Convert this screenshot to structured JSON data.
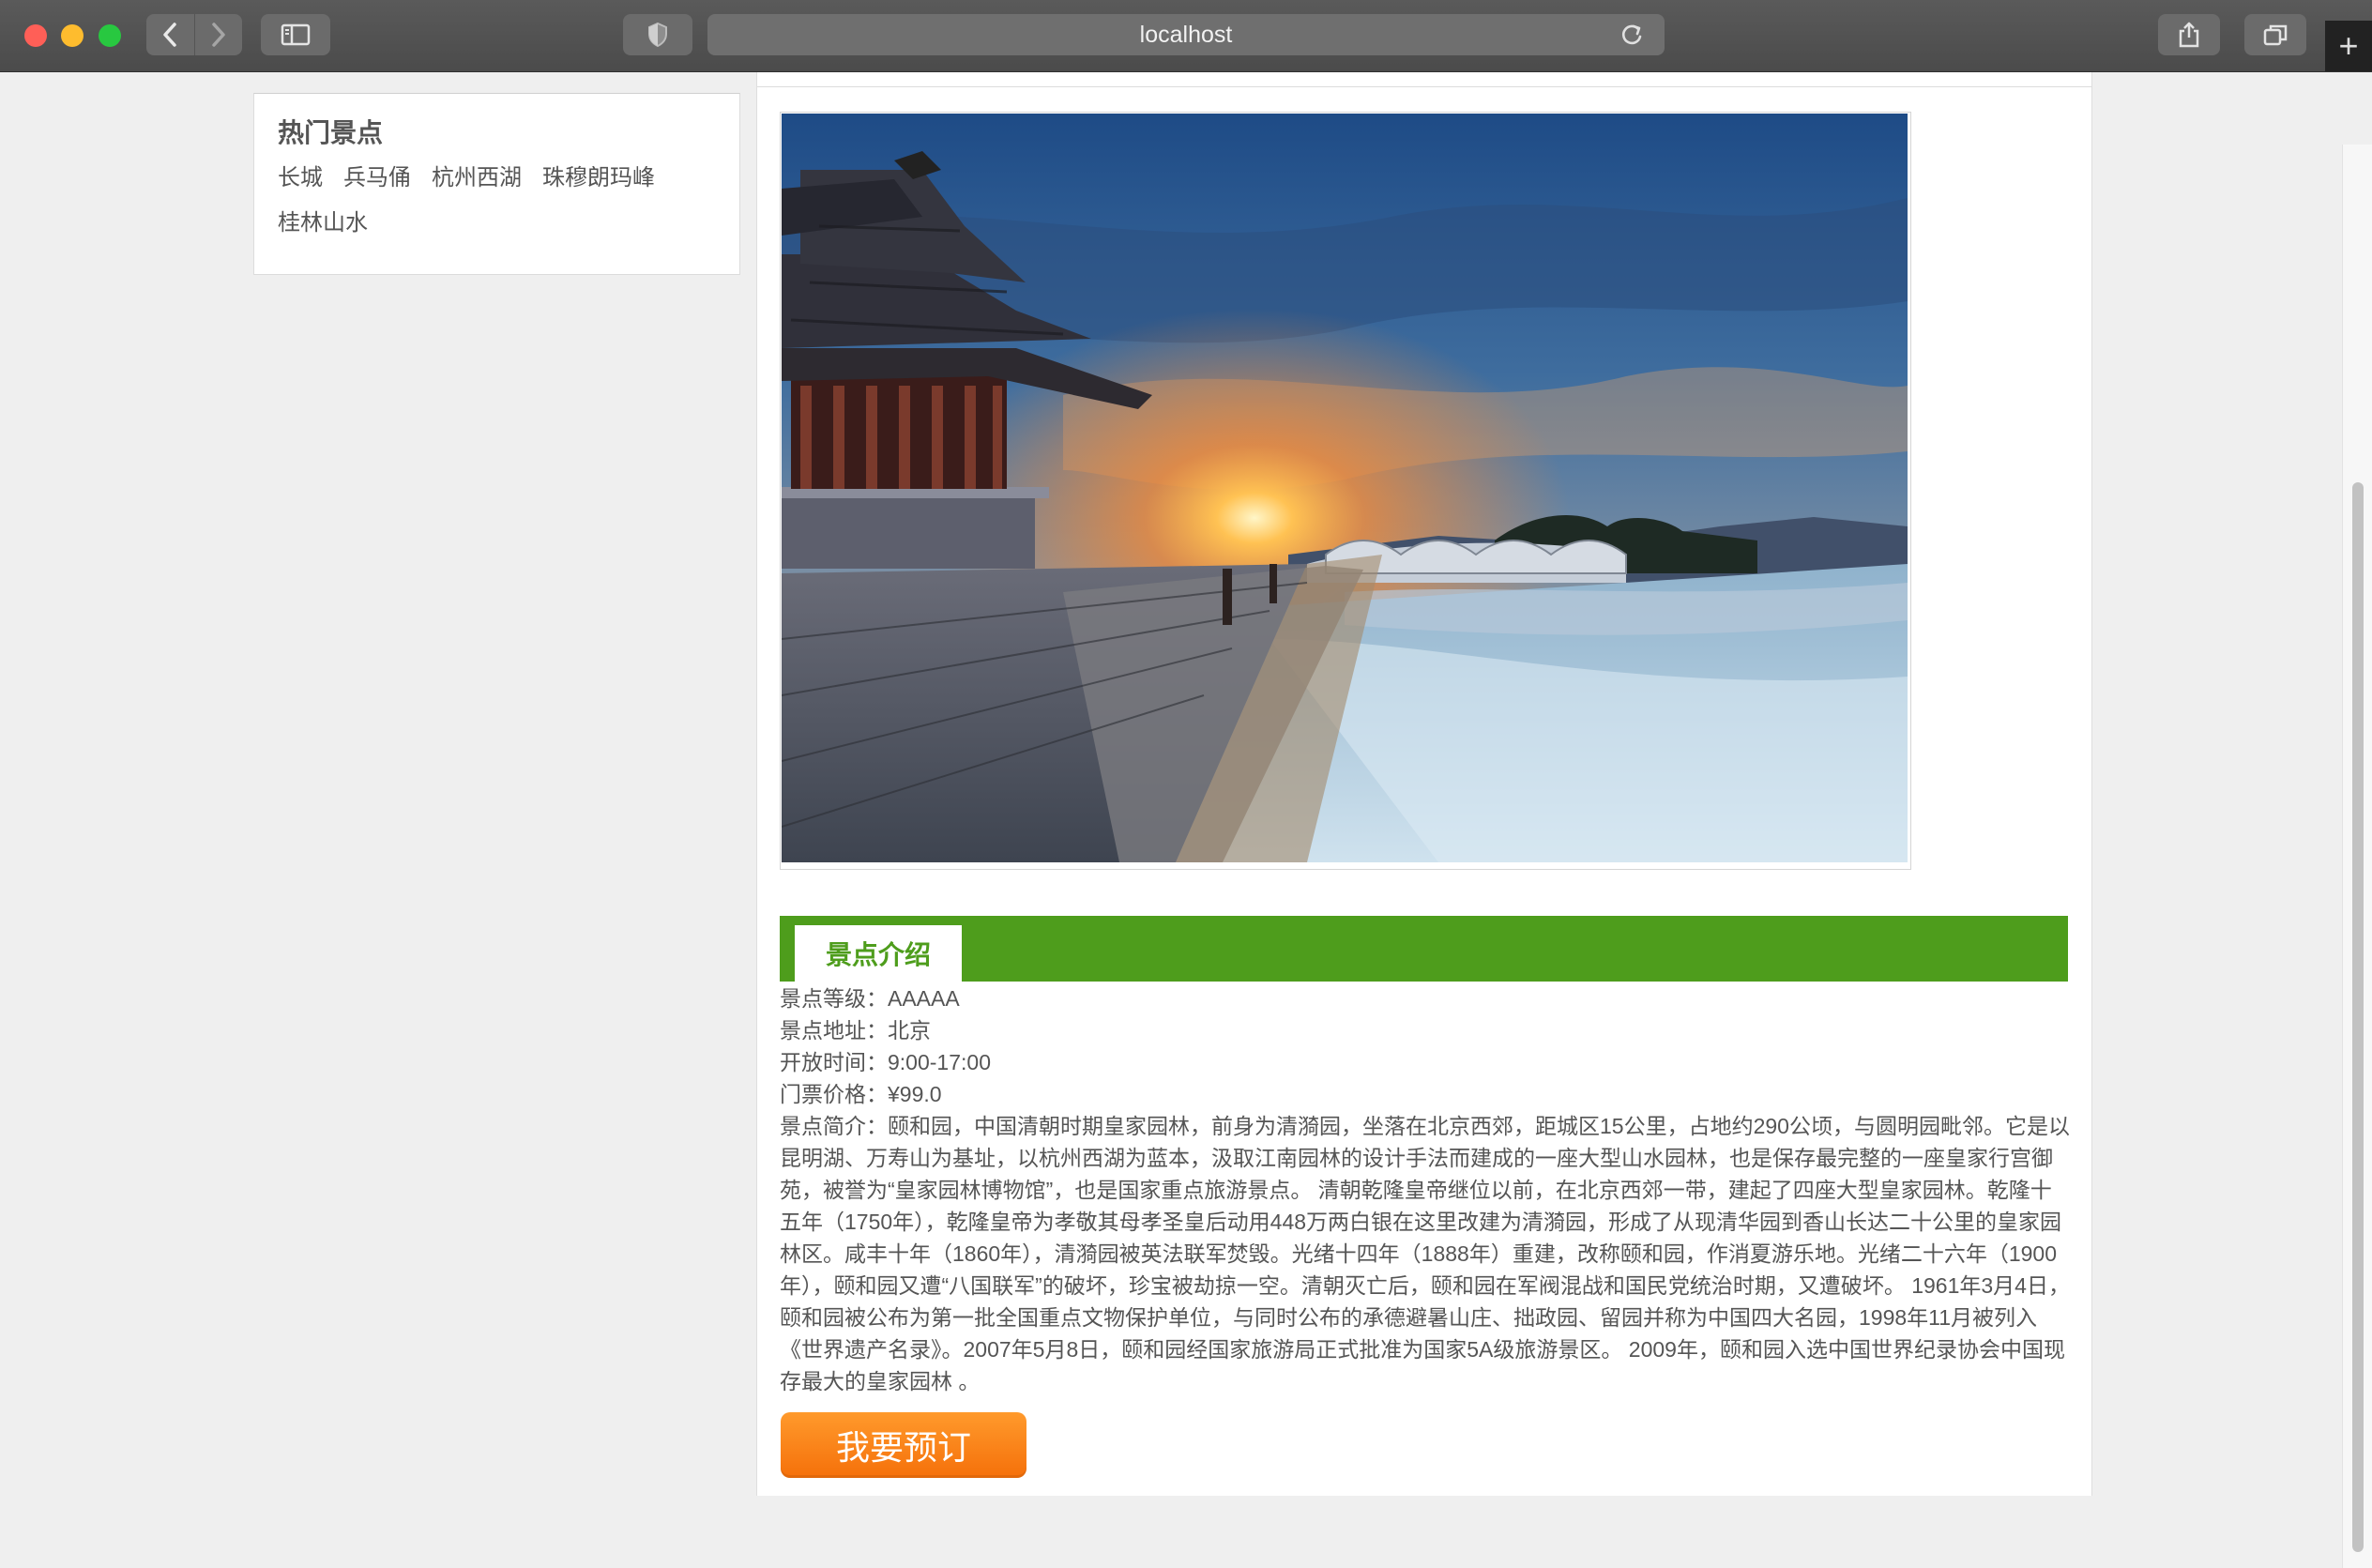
{
  "browser": {
    "url": "localhost",
    "nav_back_icon": "chevron-left-icon",
    "nav_forward_icon": "chevron-right-icon"
  },
  "sidebar": {
    "title": "热门景点",
    "links": [
      "长城",
      "兵马俑",
      "杭州西湖",
      "珠穆朗玛峰",
      "桂林山水"
    ]
  },
  "main": {
    "photo_alt": "颐和园十七孔桥冬日夕阳",
    "section_tab": "景点介绍",
    "rows": [
      {
        "label": "景点等级：",
        "value": "AAAAA"
      },
      {
        "label": "景点地址：",
        "value": "北京"
      },
      {
        "label": "开放时间：",
        "value": "9:00-17:00"
      },
      {
        "label": "门票价格：",
        "value": "¥99.0"
      }
    ],
    "desc_label": "景点简介：",
    "desc": "颐和园，中国清朝时期皇家园林，前身为清漪园，坐落在北京西郊，距城区15公里，占地约290公顷，与圆明园毗邻。它是以昆明湖、万寿山为基址，以杭州西湖为蓝本，汲取江南园林的设计手法而建成的一座大型山水园林，也是保存最完整的一座皇家行宫御苑，被誉为“皇家园林博物馆”，也是国家重点旅游景点。 清朝乾隆皇帝继位以前，在北京西郊一带，建起了四座大型皇家园林。乾隆十五年（1750年），乾隆皇帝为孝敬其母孝圣皇后动用448万两白银在这里改建为清漪园，形成了从现清华园到香山长达二十公里的皇家园林区。咸丰十年（1860年），清漪园被英法联军焚毁。光绪十四年（1888年）重建，改称颐和园，作消夏游乐地。光绪二十六年（1900年），颐和园又遭“八国联军”的破坏，珍宝被劫掠一空。清朝灭亡后，颐和园在军阀混战和国民党统治时期，又遭破坏。 1961年3月4日，颐和园被公布为第一批全国重点文物保护单位，与同时公布的承德避暑山庄、拙政园、留园并称为中国四大名园，1998年11月被列入《世界遗产名录》。2007年5月8日，颐和园经国家旅游局正式批准为国家5A级旅游景区。 2009年，颐和园入选中国世界纪录协会中国现存最大的皇家园林 。",
    "book_button": "我要预订"
  }
}
